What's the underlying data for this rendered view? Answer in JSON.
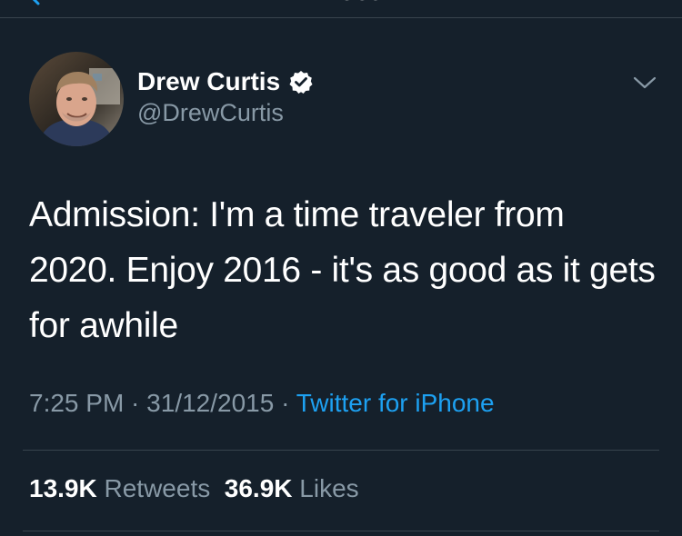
{
  "nav": {
    "title": "Tweet",
    "back_icon": "chevron-left-icon"
  },
  "tweet": {
    "author_name": "Drew Curtis",
    "author_handle": "@DrewCurtis",
    "verified_icon": "verified-badge-icon",
    "more_icon": "chevron-down-icon",
    "text": "Admission: I'm a time traveler from 2020. Enjoy 2016 - it's as good as it gets for awhile",
    "time": "7:25 PM",
    "date": "31/12/2015",
    "separator": " · ",
    "source": "Twitter for iPhone"
  },
  "stats": {
    "retweets_count": "13.9K",
    "retweets_label": "Retweets",
    "likes_count": "36.9K",
    "likes_label": "Likes"
  },
  "colors": {
    "background": "#15202b",
    "secondary_text": "#8899a6",
    "accent": "#1da1f2",
    "divider": "#38444d"
  }
}
